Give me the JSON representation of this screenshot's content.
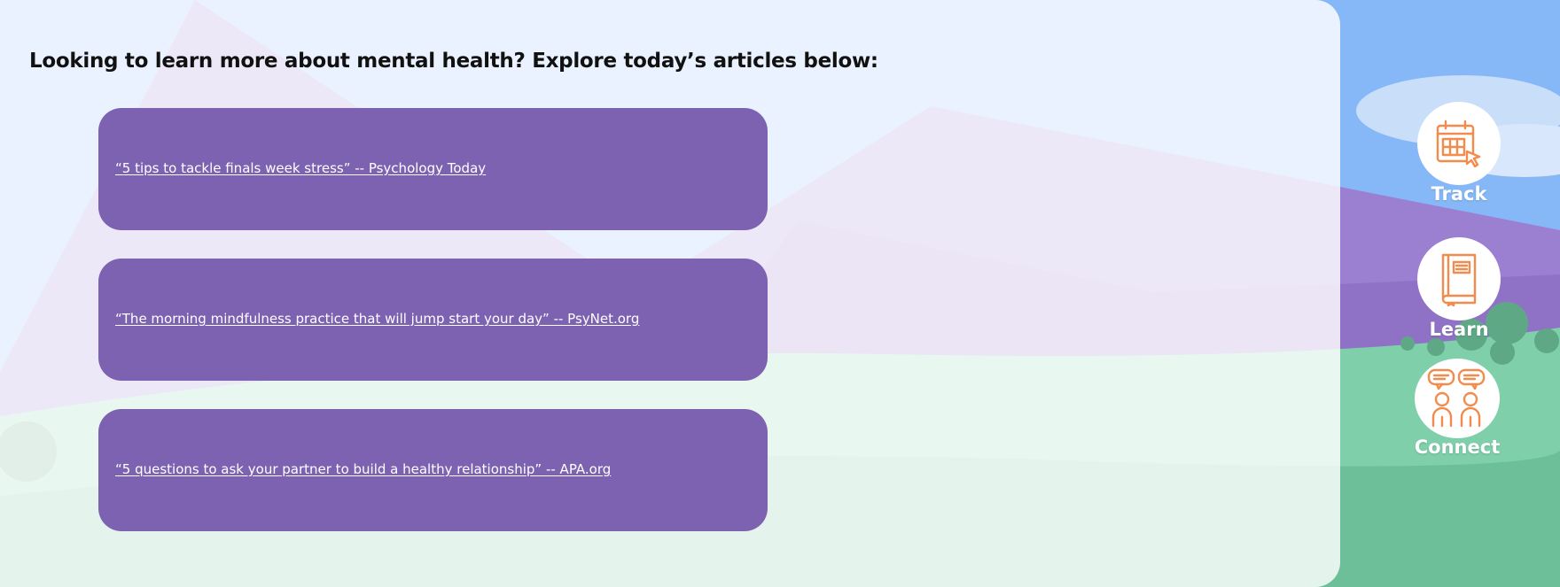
{
  "page": {
    "heading": "Looking to learn more about mental health? Explore today’s articles below:"
  },
  "articles": [
    {
      "label": "“5 tips to tackle finals week stress” -- Psychology Today"
    },
    {
      "label": "“The morning mindfulness practice that will jump start your day” -- PsyNet.org"
    },
    {
      "label": "“5 questions to ask your partner to build a healthy relationship” -- APA.org"
    }
  ],
  "nav": {
    "items": [
      {
        "label": "Track",
        "icon": "calendar-cursor-icon"
      },
      {
        "label": "Learn",
        "icon": "book-icon"
      },
      {
        "label": "Connect",
        "icon": "people-chat-icon"
      }
    ]
  },
  "colors": {
    "card": "#7d62b2",
    "icon_accent": "#f28b4c",
    "sky": "#86b8f7",
    "mountain": "#9b7fd0",
    "grass": "#7fcfaa"
  }
}
